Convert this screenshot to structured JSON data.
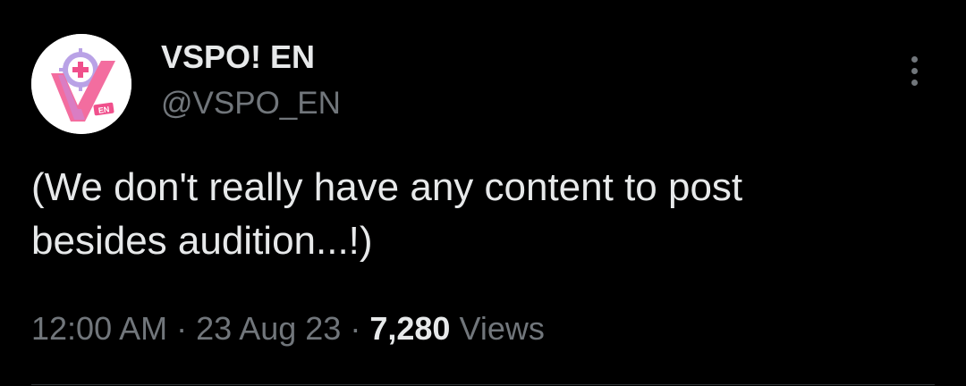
{
  "account": {
    "display_name": "VSPO! EN",
    "handle": "@VSPO_EN",
    "avatar_badge": "EN"
  },
  "tweet": {
    "text_line1": "(We don't really have any content to post",
    "text_line2": "besides audition...!)",
    "time": "12:00 AM",
    "separator": "·",
    "date": "23 Aug 23",
    "views_count": "7,280",
    "views_label": "Views"
  },
  "icons": {
    "more": "more-vertical-icon"
  },
  "colors": {
    "background": "#000000",
    "primary_text": "#e7e9ea",
    "secondary_text": "#71767b",
    "brand_pink": "#f0508c",
    "brand_lilac": "#b9a2e6"
  }
}
